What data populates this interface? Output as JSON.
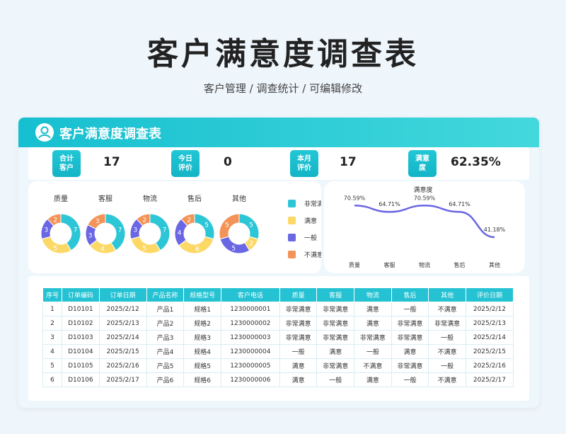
{
  "page": {
    "title": "客户满意度调查表",
    "subtitle": "客户管理 / 调查统计 /  可编辑修改"
  },
  "card": {
    "title": "客户满意度调查表"
  },
  "stats": [
    {
      "label": "合计\n客户",
      "value": "17"
    },
    {
      "label": "今日\n评价",
      "value": "0"
    },
    {
      "label": "本月\n评价",
      "value": "17"
    },
    {
      "label": "满意\n度",
      "value": "62.35%"
    }
  ],
  "colors": {
    "accent": "#1cbfd0",
    "very_satisfied": "#2cc6d6",
    "satisfied": "#fcd967",
    "average": "#6a66e4",
    "unsatisfied": "#f39357",
    "line": "#6a66e4"
  },
  "legend": [
    "非常满意",
    "满意",
    "一般",
    "不满意"
  ],
  "chart_data": [
    {
      "type": "pie",
      "variant": "donut",
      "charts": [
        {
          "title": "质量",
          "values": [
            7,
            5,
            3,
            2
          ]
        },
        {
          "title": "客服",
          "values": [
            7,
            4,
            3,
            3
          ]
        },
        {
          "title": "物流",
          "values": [
            7,
            5,
            3,
            2
          ]
        },
        {
          "title": "售后",
          "values": [
            5,
            6,
            4,
            2
          ]
        },
        {
          "title": "其他",
          "values": [
            5,
            2,
            5,
            5
          ]
        }
      ],
      "legend": [
        "非常满意",
        "满意",
        "一般",
        "不满意"
      ]
    },
    {
      "type": "line",
      "title": "满意度",
      "categories": [
        "质量",
        "客服",
        "物流",
        "售后",
        "其他"
      ],
      "values": [
        70.59,
        64.71,
        70.59,
        64.71,
        41.18
      ],
      "labels": [
        "70.59%",
        "64.71%",
        "70.59%",
        "64.71%",
        "41.18%"
      ],
      "ylim": [
        30,
        80
      ]
    }
  ],
  "table": {
    "headers": [
      "序号",
      "订单编码",
      "订单日期",
      "产品名称",
      "规格型号",
      "客户电话",
      "质量",
      "客服",
      "物流",
      "售后",
      "其他",
      "评价日期"
    ],
    "rows": [
      [
        "1",
        "D10101",
        "2025/2/12",
        "产品1",
        "规格1",
        "1230000001",
        "非常满意",
        "非常满意",
        "满意",
        "一般",
        "不满意",
        "2025/2/12"
      ],
      [
        "2",
        "D10102",
        "2025/2/13",
        "产品2",
        "规格2",
        "1230000002",
        "非常满意",
        "非常满意",
        "满意",
        "非常满意",
        "非常满意",
        "2025/2/13"
      ],
      [
        "3",
        "D10103",
        "2025/2/14",
        "产品3",
        "规格3",
        "1230000003",
        "非常满意",
        "非常满意",
        "非常满意",
        "非常满意",
        "一般",
        "2025/2/14"
      ],
      [
        "4",
        "D10104",
        "2025/2/15",
        "产品4",
        "规格4",
        "1230000004",
        "一般",
        "满意",
        "一般",
        "满意",
        "不满意",
        "2025/2/15"
      ],
      [
        "5",
        "D10105",
        "2025/2/16",
        "产品5",
        "规格5",
        "1230000005",
        "满意",
        "非常满意",
        "不满意",
        "非常满意",
        "一般",
        "2025/2/16"
      ],
      [
        "6",
        "D10106",
        "2025/2/17",
        "产品6",
        "规格6",
        "1230000006",
        "满意",
        "一般",
        "满意",
        "一般",
        "不满意",
        "2025/2/17"
      ]
    ]
  }
}
